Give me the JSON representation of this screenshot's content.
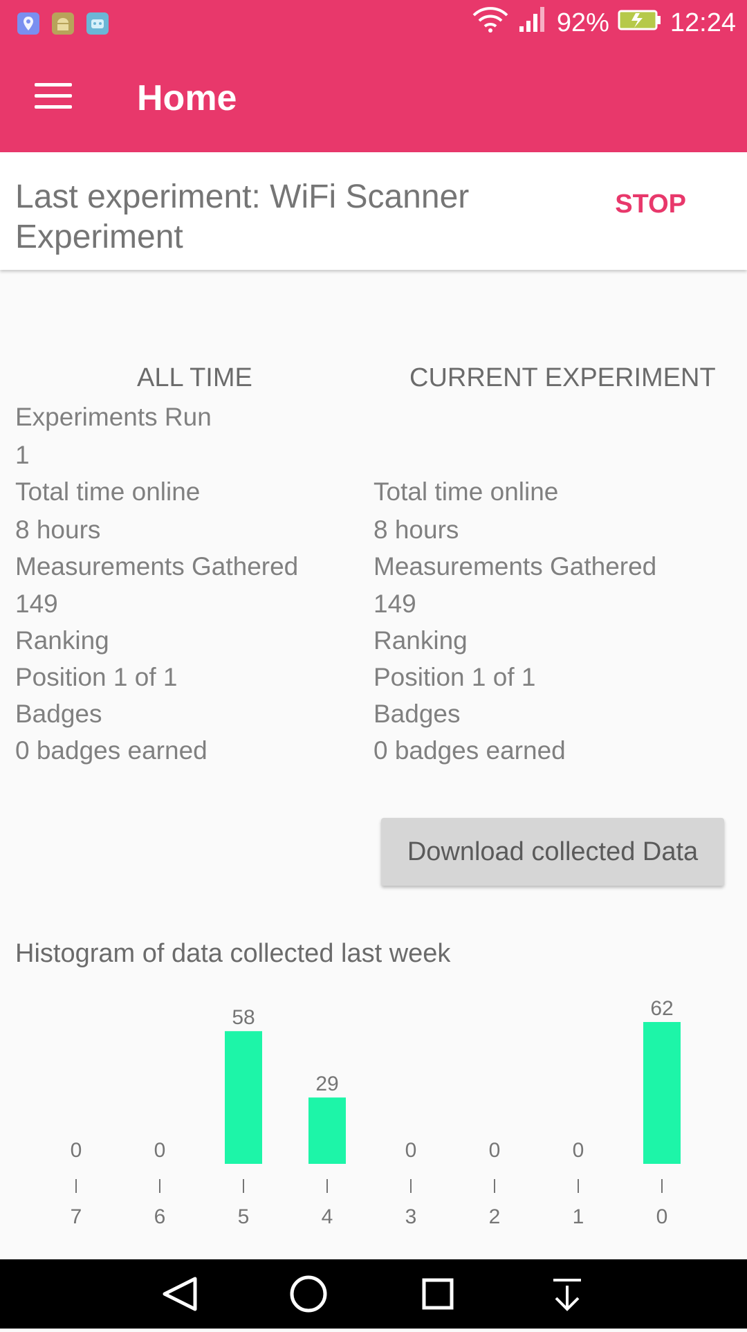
{
  "status_bar": {
    "battery": "92%",
    "time": "12:24"
  },
  "app_bar": {
    "title": "Home"
  },
  "experiment": {
    "last_label": "Last experiment: WiFi Scanner Experiment",
    "stop_label": "STOP"
  },
  "all_time": {
    "header": "ALL TIME",
    "experiments_run_label": "Experiments Run",
    "experiments_run_value": "1",
    "time_label": "Total time online",
    "time_value": "8 hours",
    "measurements_label": "Measurements Gathered",
    "measurements_value": "149",
    "ranking_label": "Ranking",
    "ranking_value": "Position 1 of 1",
    "badges_label": "Badges",
    "badges_value": "0 badges earned"
  },
  "current": {
    "header": "CURRENT EXPERIMENT",
    "time_label": "Total time online",
    "time_value": "8 hours",
    "measurements_label": "Measurements Gathered",
    "measurements_value": "149",
    "ranking_label": "Ranking",
    "ranking_value": "Position 1 of 1",
    "badges_label": "Badges",
    "badges_value": "0 badges earned"
  },
  "download_label": "Download collected Data",
  "histogram_title": "Histogram of data collected last week",
  "colors": {
    "primary": "#e8386b",
    "bar": "#1df5a8"
  },
  "chart_data": {
    "type": "bar",
    "categories": [
      "7",
      "6",
      "5",
      "4",
      "3",
      "2",
      "1",
      "0"
    ],
    "values": [
      0,
      0,
      58,
      29,
      0,
      0,
      0,
      62
    ]
  }
}
